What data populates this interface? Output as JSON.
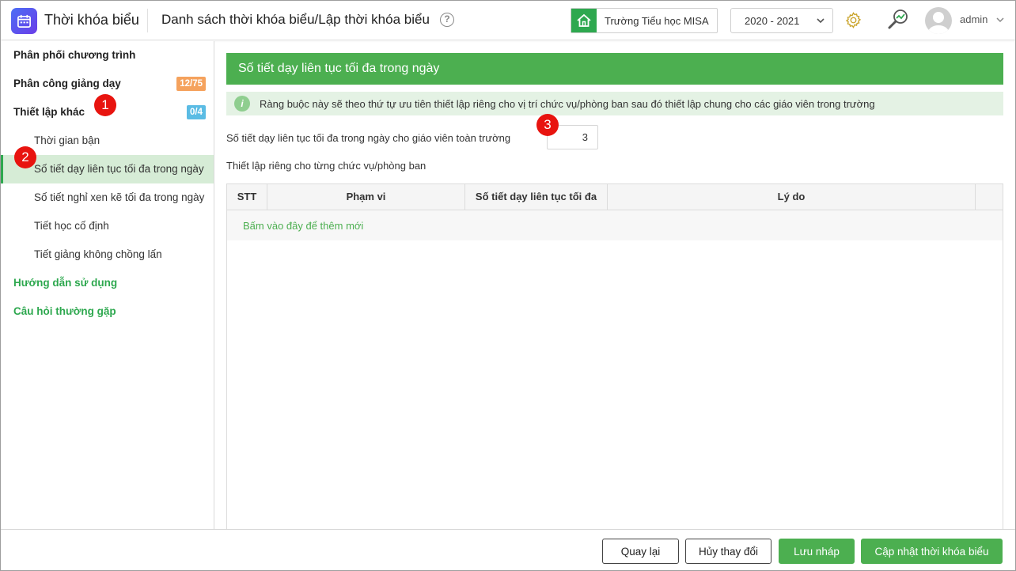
{
  "app": {
    "title": "Thời khóa biểu"
  },
  "header": {
    "page_title": "Danh sách thời khóa biểu/Lập thời khóa biểu",
    "help_symbol": "?",
    "school_name": "Trường Tiểu học MISA",
    "school_year": "2020 - 2021",
    "user_name": "admin"
  },
  "sidebar": {
    "items": [
      {
        "label": "Phân phối chương trình"
      },
      {
        "label": "Phân công giảng dạy",
        "badge": "12/75"
      },
      {
        "label": "Thiết lập khác",
        "badge": "0/4"
      },
      {
        "label": "Thời gian bận"
      },
      {
        "label": "Số tiết dạy liên tục tối đa trong ngày"
      },
      {
        "label": "Số tiết nghỉ xen kẽ tối đa trong ngày"
      },
      {
        "label": "Tiết học cố định"
      },
      {
        "label": "Tiết giảng không chồng lấn"
      },
      {
        "label": "Hướng dẫn sử dụng"
      },
      {
        "label": "Câu hỏi thường gặp"
      }
    ]
  },
  "steps": [
    "1",
    "2",
    "3"
  ],
  "main": {
    "section_title": "Số tiết dạy liên tục tối đa trong ngày",
    "info_text": "Ràng buộc này sẽ theo thứ tự ưu tiên thiết lập riêng cho vị trí chức vụ/phòng ban sau đó thiết lập chung cho các giáo viên trong trường",
    "max_label": "Số tiết dạy liên tục tối đa trong ngày cho giáo viên toàn trường",
    "max_value": "3",
    "custom_label": "Thiết lập riêng cho từng chức vụ/phòng ban",
    "table": {
      "columns": [
        "STT",
        "Phạm vi",
        "Số tiết dạy liên tục tối đa",
        "Lý do"
      ],
      "add_link": "Bấm vào đây để thêm mới"
    }
  },
  "footer": {
    "back": "Quay lại",
    "cancel": "Hủy thay đổi",
    "save_draft": "Lưu nháp",
    "update": "Cập nhật thời khóa biểu"
  },
  "colors": {
    "accent": "#4caf50",
    "active_bg": "#d6ecd6",
    "step_marker": "#e8140f",
    "badge_orange": "#f5a25d",
    "badge_blue": "#5bbce4"
  }
}
